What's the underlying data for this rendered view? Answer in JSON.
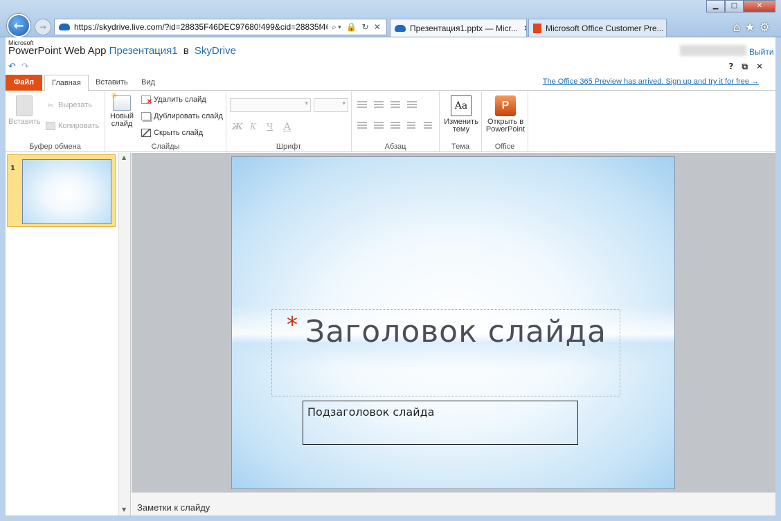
{
  "browser": {
    "url": "https://skydrive.live.com/?id=28835F46DEC97680!499&cid=28835f46d",
    "address_tools": "⌕▾ 🔒 ↻ ✕",
    "tabs": [
      {
        "title": "Презентация1.pptx — Micr...",
        "close": "✕"
      },
      {
        "title": "Microsoft Office Customer Pre..."
      }
    ],
    "window_controls": {
      "minimize": "▁",
      "maximize": "□",
      "close": "✕"
    },
    "toolbar_icons": [
      "home-icon",
      "favorites-icon",
      "settings-icon"
    ]
  },
  "app": {
    "brand_small": "Microsoft",
    "brand": "PowerPoint Web App",
    "document": "Презентация1",
    "in_word": "в",
    "location": "SkyDrive",
    "sign_out": "Выйти",
    "help": "?"
  },
  "ribbon": {
    "tabs": [
      "Файл",
      "Главная",
      "Вставить",
      "Вид"
    ],
    "promo": "The Office 365 Preview has arrived. Sign up and try it for free →",
    "clipboard": {
      "paste": "Вставить",
      "cut": "Вырезать",
      "copy": "Копировать",
      "group": "Буфер обмена"
    },
    "slides": {
      "new_slide": "Новый слайд",
      "delete": "Удалить слайд",
      "duplicate": "Дублировать слайд",
      "hide": "Скрыть слайд",
      "group": "Слайды"
    },
    "font": {
      "bold": "Ж",
      "italic": "К",
      "underline": "Ч",
      "color": "А",
      "group": "Шрифт"
    },
    "paragraph": {
      "group": "Абзац"
    },
    "theme": {
      "change": "Изменить тему",
      "group": "Тема"
    },
    "office": {
      "open": "Открыть в PowerPoint",
      "group": "Office"
    }
  },
  "thumbnails": [
    {
      "number": "1"
    }
  ],
  "slide": {
    "title": "Заголовок слайда",
    "subtitle": "Подзаголовок слайда",
    "bullet": "*"
  },
  "notes": {
    "placeholder": "Заметки к слайду"
  }
}
